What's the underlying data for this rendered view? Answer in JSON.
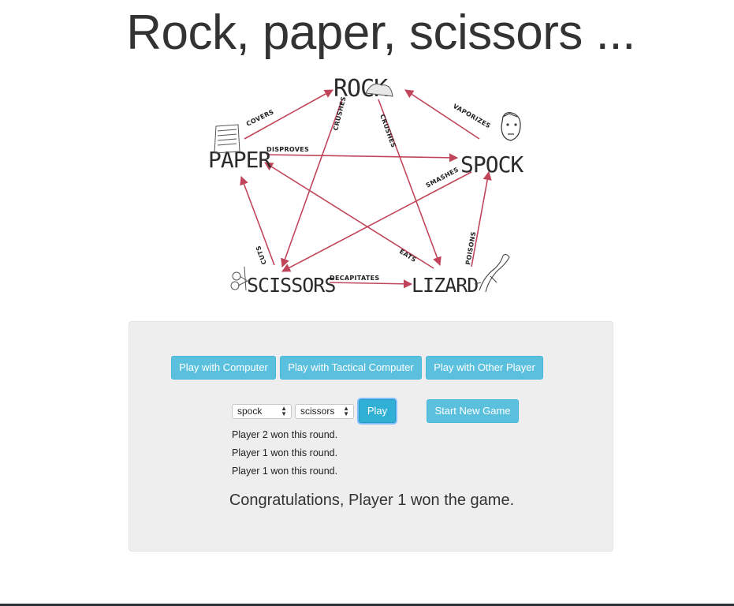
{
  "page": {
    "title": "Rock, paper, scissors ..."
  },
  "diagram": {
    "nodes": {
      "rock": "ROCK",
      "paper": "PAPER",
      "spock": "SPOCK",
      "scissors": "SCISSORS",
      "lizard": "LIZARD"
    },
    "edges": {
      "covers": "COVERS",
      "vaporizes": "VAPORIZES",
      "crushes_1": "CRUSHES",
      "crushes_2": "CRUSHES",
      "disproves": "DISPROVES",
      "smashes": "SMASHES",
      "cuts": "CUTS",
      "eats": "EATS",
      "poisons": "POISONS",
      "decapitates": "DECAPITATES"
    },
    "arrow_color": "#c0455a"
  },
  "game": {
    "mode_buttons": [
      "Play with Computer",
      "Play with Tactical Computer",
      "Play with Other Player"
    ],
    "player1_choice": "spock",
    "player2_choice": "scissors",
    "play_button": "Play",
    "new_game_button": "Start New Game",
    "results": [
      "Player 2 won this round.",
      "Player 1 won this round.",
      "Player 1 won this round."
    ],
    "final_message": "Congratulations, Player 1 won the game."
  },
  "colors": {
    "accent": "#5bc0de",
    "well": "#eeeeee",
    "text": "#333333"
  }
}
